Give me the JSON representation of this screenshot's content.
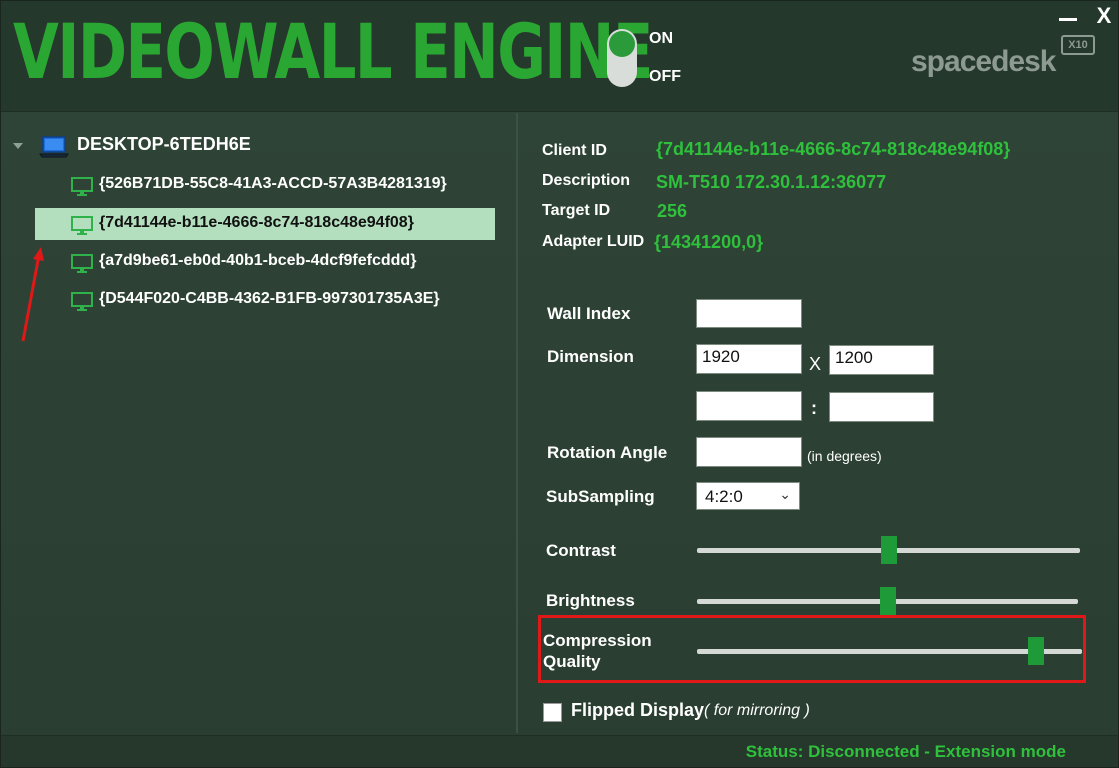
{
  "header": {
    "app_title": "VIDEOWALL ENGINE",
    "toggle": {
      "on_label": "ON",
      "off_label": "OFF",
      "state": "on"
    },
    "brand": "spacedesk",
    "brand_badge": "X10",
    "minimize_icon": "minimize-icon",
    "close_label": "X"
  },
  "tree": {
    "root_label": "DESKTOP-6TEDH6E",
    "items": [
      {
        "label": "{526B71DB-55C8-41A3-ACCD-57A3B4281319}",
        "selected": false
      },
      {
        "label": "{7d41144e-b11e-4666-8c74-818c48e94f08}",
        "selected": true
      },
      {
        "label": "{a7d9be61-eb0d-40b1-bceb-4dcf9fefcddd}",
        "selected": false
      },
      {
        "label": "{D544F020-C4BB-4362-B1FB-997301735A3E}",
        "selected": false
      }
    ]
  },
  "details": {
    "client_id_label": "Client ID",
    "client_id_value": "{7d41144e-b11e-4666-8c74-818c48e94f08}",
    "description_label": "Description",
    "description_value": "SM-T510 172.30.1.12:36077",
    "target_id_label": "Target ID",
    "target_id_value": "256",
    "adapter_luid_label": "Adapter LUID",
    "adapter_luid_value": "{14341200,0}"
  },
  "settings": {
    "wall_index_label": "Wall Index",
    "wall_index_value": "",
    "dimension_label": "Dimension",
    "width_value": "1920",
    "dim_separator": "X",
    "height_value": "1200",
    "ratio_left_value": "",
    "ratio_separator": ":",
    "ratio_right_value": "",
    "rotation_label": "Rotation Angle",
    "rotation_value": "",
    "rotation_hint": "(in degrees)",
    "subsampling_label": "SubSampling",
    "subsampling_value": "4:2:0",
    "contrast_label": "Contrast",
    "contrast_level": 0.5,
    "brightness_label": "Brightness",
    "brightness_level": 0.5,
    "compression_label_line1": "Compression",
    "compression_label_line2": "Quality",
    "compression_level": 0.88,
    "flipped_label": "Flipped Display",
    "flipped_hint": "( for mirroring )",
    "flipped_checked": false
  },
  "status": {
    "text": "Status:  Disconnected - Extension mode"
  },
  "colors": {
    "accent_green": "#2aa632",
    "value_green": "#2fc03c",
    "selection_bg": "#b3dfbe",
    "annotation_red": "#e01818"
  }
}
